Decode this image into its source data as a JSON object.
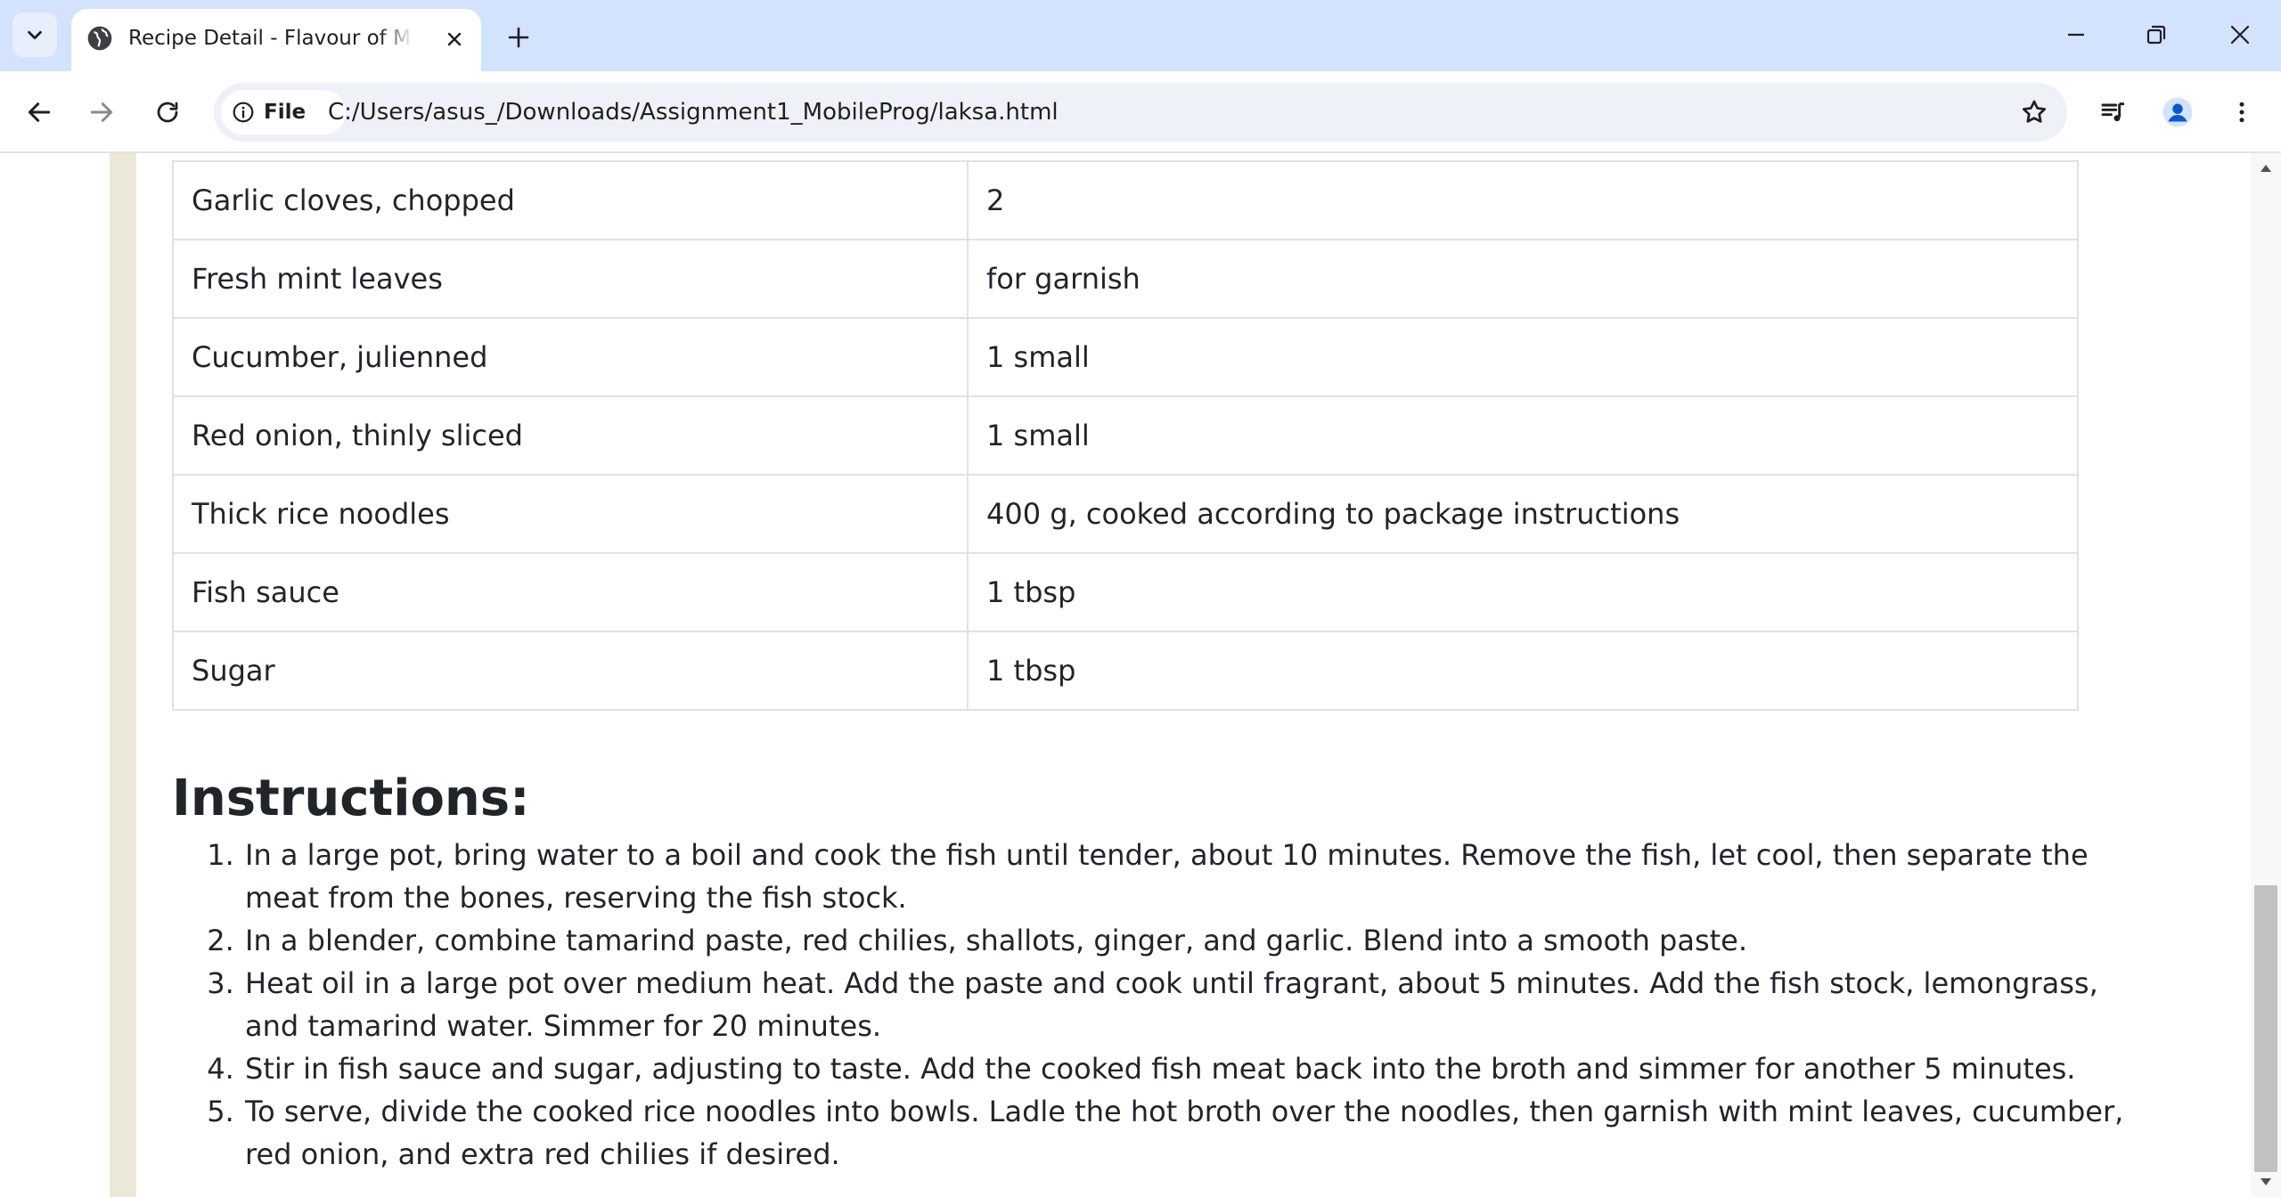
{
  "browser": {
    "tab": {
      "title": "Recipe Detail - Flavour of Malaysia"
    },
    "address_bar": {
      "security_chip_label": "File",
      "url": "C:/Users/asus_/Downloads/Assignment1_MobileProg/laksa.html"
    }
  },
  "page": {
    "ingredients": [
      {
        "name": "Garlic cloves, chopped",
        "amount": "2"
      },
      {
        "name": "Fresh mint leaves",
        "amount": "for garnish"
      },
      {
        "name": "Cucumber, julienned",
        "amount": "1 small"
      },
      {
        "name": "Red onion, thinly sliced",
        "amount": "1 small"
      },
      {
        "name": "Thick rice noodles",
        "amount": "400 g, cooked according to package instructions"
      },
      {
        "name": "Fish sauce",
        "amount": "1 tbsp"
      },
      {
        "name": "Sugar",
        "amount": "1 tbsp"
      }
    ],
    "instructions_heading": "Instructions:",
    "instructions": [
      "In a large pot, bring water to a boil and cook the fish until tender, about 10 minutes. Remove the fish, let cool, then separate the meat from the bones, reserving the fish stock.",
      "In a blender, combine tamarind paste, red chilies, shallots, ginger, and garlic. Blend into a smooth paste.",
      "Heat oil in a large pot over medium heat. Add the paste and cook until fragrant, about 5 minutes. Add the fish stock, lemongrass, and tamarind water. Simmer for 20 minutes.",
      "Stir in fish sauce and sugar, adjusting to taste. Add the cooked fish meat back into the broth and simmer for another 5 minutes.",
      "To serve, divide the cooked rice noodles into bowls. Ladle the hot broth over the noodles, then garnish with mint leaves, cucumber, red onion, and extra red chilies if desired."
    ]
  },
  "colors": {
    "tabstrip_bg": "#d3e3fd",
    "page_side_bg": "#ece8d7",
    "text": "#212529",
    "table_border": "#dee2e6"
  }
}
